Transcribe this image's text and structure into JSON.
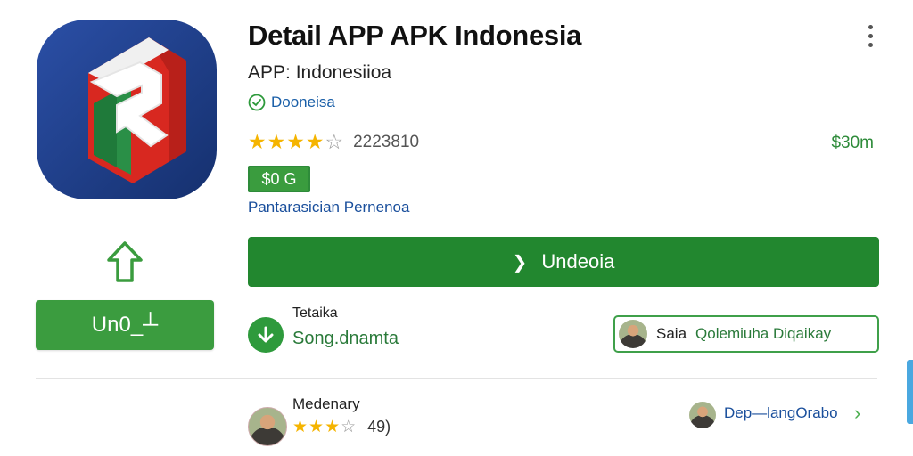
{
  "header": {
    "title": "Detail APP APK Indonesia",
    "subtitle": "APP: Indonesiioa",
    "developer": "Dooneisa",
    "rating_count": "2223810",
    "price_right": "$30m",
    "price_badge": "$0 G",
    "category": "Pantarasician Pernenoa"
  },
  "rating": {
    "stars": 4,
    "max_stars": 5
  },
  "left_panel": {
    "update_button_label": "Un0_┴"
  },
  "install": {
    "label": "Undeoia"
  },
  "download": {
    "label": "Tetaika",
    "value": "Song.dnamta"
  },
  "review_chip": {
    "first": "Saia",
    "second": "Qolemiuha Diqaikay"
  },
  "review": {
    "reviewer": "Medenary",
    "score": "49)",
    "stars": 3,
    "max_stars": 5
  },
  "developer_link": {
    "label": "Dep—langOrabo"
  },
  "colors": {
    "primary_green": "#22872f",
    "accent_blue": "#1a4f9c",
    "star": "#f5b400",
    "icon_red": "#d8261d",
    "icon_navy": "#1c3f8f"
  },
  "icons": {
    "app": "app-logo-icon",
    "up": "arrow-up-icon",
    "verified": "verified-check-icon",
    "download": "download-arrow-icon",
    "chevron": "chevron-right-icon",
    "menu": "more-vert-icon"
  }
}
